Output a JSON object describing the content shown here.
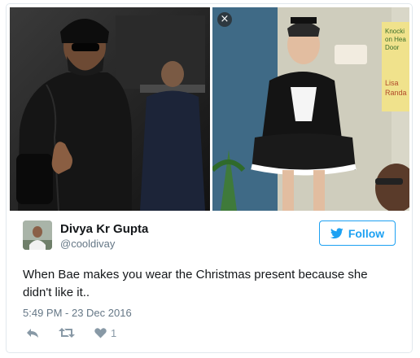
{
  "media": {
    "close_glyph": "×",
    "right_photo_book_text": "Knocki on Hea Door Lisa Randa"
  },
  "author": {
    "display_name": "Divya Kr Gupta",
    "handle": "@cooldivay"
  },
  "follow": {
    "label": "Follow"
  },
  "tweet": {
    "text": "When Bae makes you wear the Christmas present because she didn't like it..",
    "timestamp": "5:49 PM - 23 Dec 2016"
  },
  "actions": {
    "reply_icon": "reply-icon",
    "retweet_icon": "retweet-icon",
    "like_icon": "heart-icon",
    "like_count": "1"
  },
  "colors": {
    "accent": "#1da1f2",
    "secondary_text": "#657786",
    "border": "#e1e8ed"
  }
}
